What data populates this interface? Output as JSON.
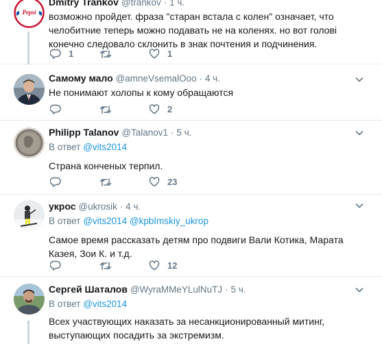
{
  "tweets": [
    {
      "name": "Dmitry Trankov",
      "screen_name": "@trankov",
      "time": "1 ч.",
      "text": "возможно пройдет. фраза \"старан встала с колен\" означает, что челобитние теперь можно подавать не на коленях. но вот голові конечно следовало склонить в знак почтения и подчинения.",
      "replies": "1",
      "retweets": "",
      "likes": "1"
    },
    {
      "name": "Самому мало",
      "screen_name": "@amneVsemalOoo",
      "time": "4 ч.",
      "text": "Не понимают холопы к кому обращаются",
      "replies": "",
      "retweets": "",
      "likes": "2"
    },
    {
      "name": "Philipp Talanov",
      "screen_name": "@Talanov1",
      "time": "5 ч.",
      "reply_label": "В ответ",
      "reply_mentions": [
        "@vits2014"
      ],
      "text": "Страна конченых терпил.",
      "replies": "",
      "retweets": "",
      "likes": "23"
    },
    {
      "name": "укрос",
      "screen_name": "@ukrosik",
      "time": "4 ч.",
      "reply_label": "В ответ",
      "reply_mentions": [
        "@vits2014",
        "@kpbImskiy_ukrop"
      ],
      "text": "Самое время рассказать детям про подвиги Вали Котика, Марата Казея, Зои К. и т.д.",
      "replies": "",
      "retweets": "",
      "likes": "12"
    },
    {
      "name": "Сергей Шаталов",
      "screen_name": "@WyraMMeYLulNuTJ",
      "time": "5 ч.",
      "reply_label": "В ответ",
      "reply_mentions": [
        "@vits2014"
      ],
      "text": "Всех участвующих наказать за несанкционированный митинг, выступающих посадить за экстремизм."
    }
  ],
  "separator": "·",
  "icons": {
    "reply": "reply-icon",
    "retweet": "retweet-icon",
    "like": "heart-icon",
    "caret": "chevron-down-icon"
  },
  "colors": {
    "link": "#1b95e0",
    "secondary": "#657786",
    "border": "#e6ecf0",
    "thread": "#ccd6dd"
  }
}
